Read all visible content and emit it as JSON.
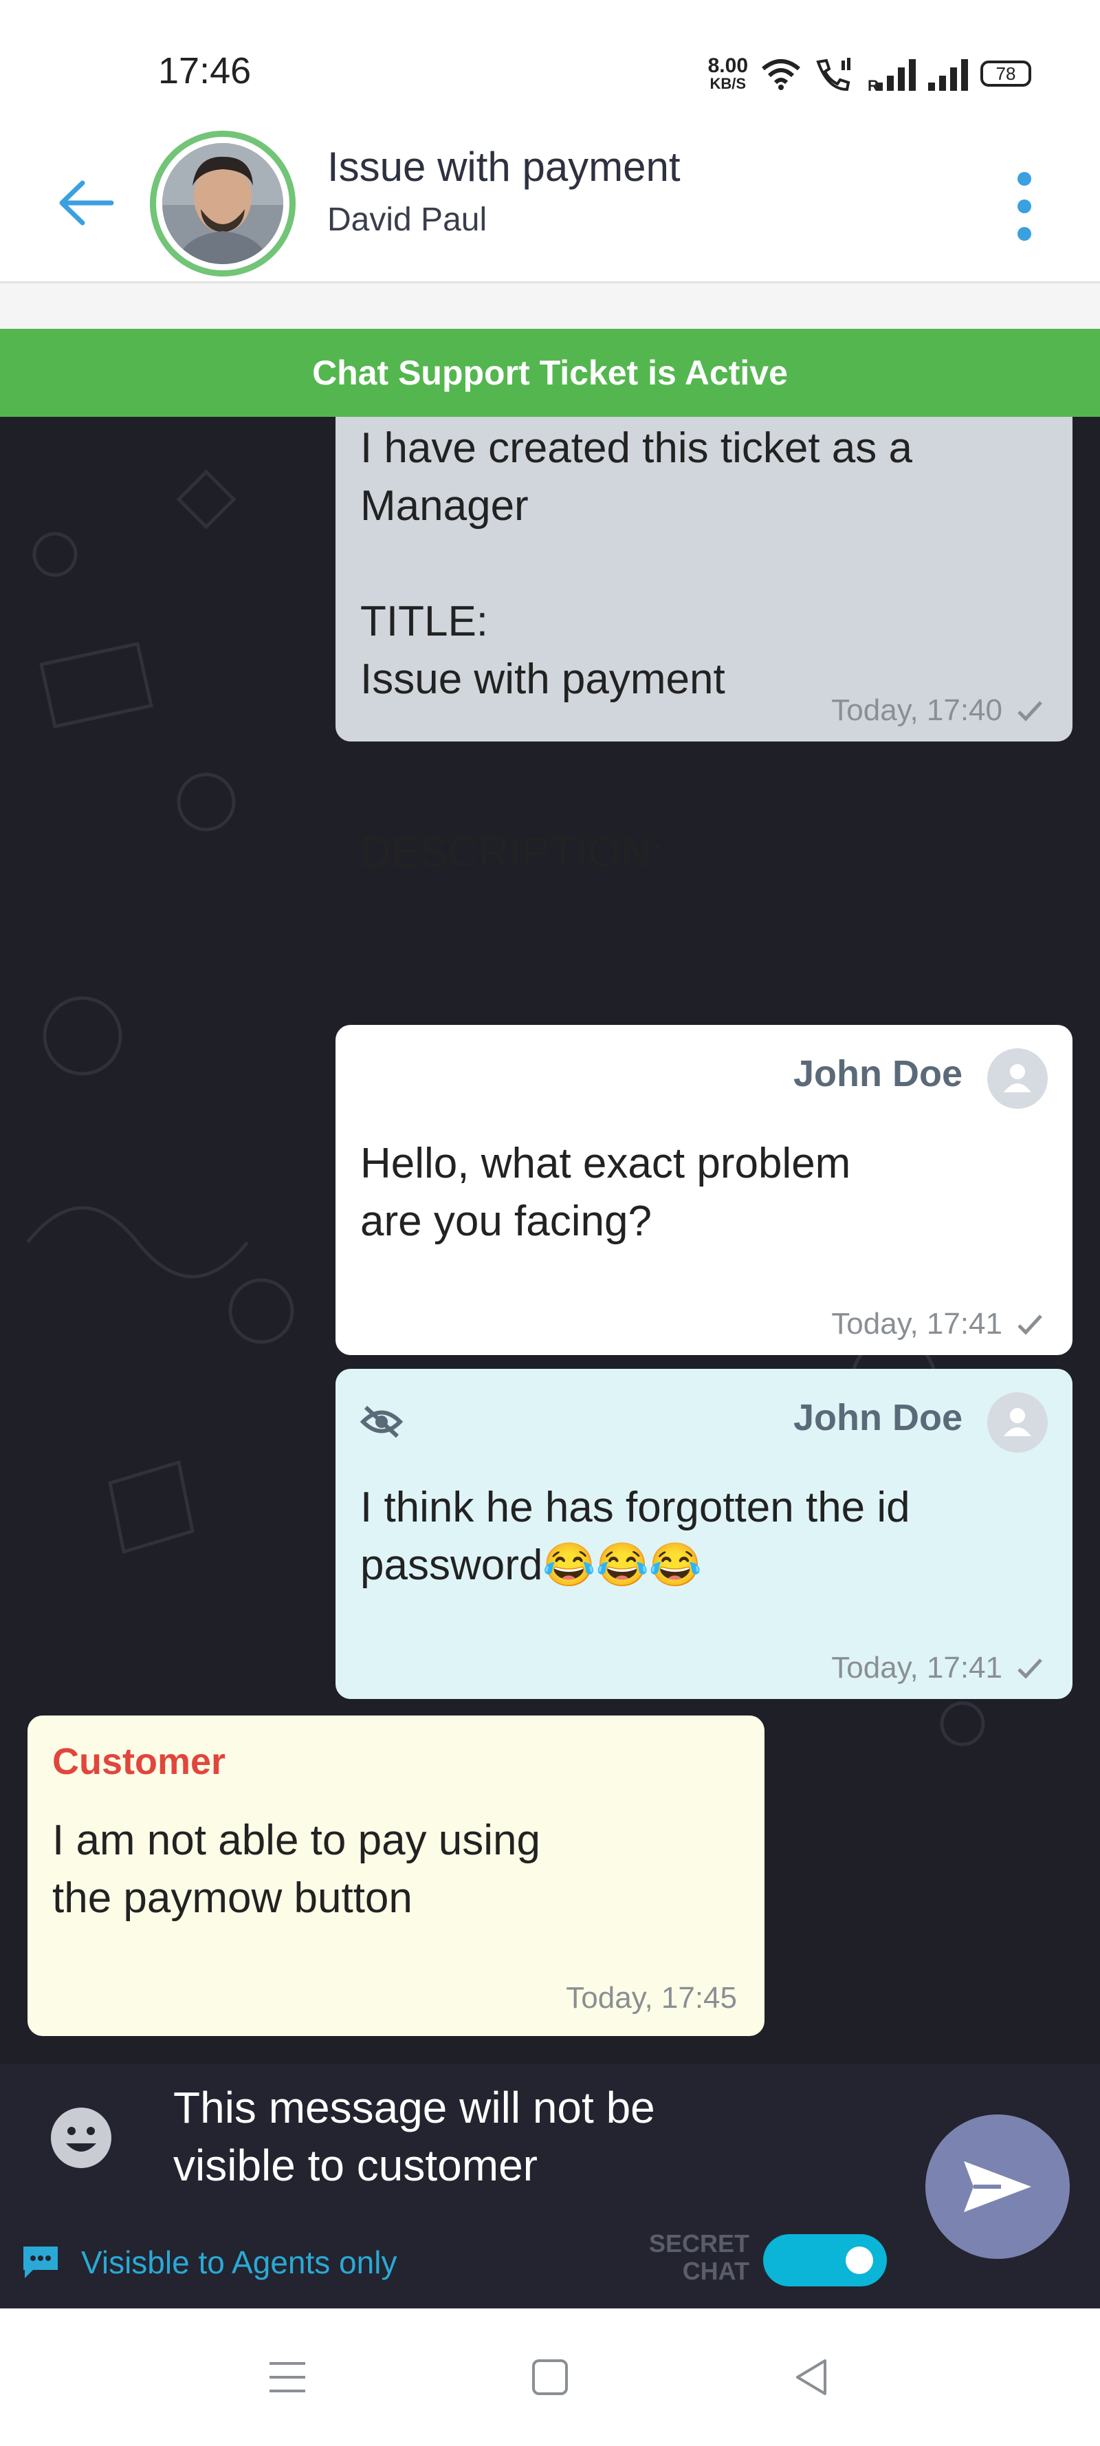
{
  "status_bar": {
    "time": "17:46",
    "net_speed": "8.00",
    "net_unit": "KB/S",
    "battery": "78",
    "icons": [
      "wifi-icon",
      "call-signal-icon",
      "signal-r-icon",
      "signal-icon",
      "battery-icon"
    ]
  },
  "header": {
    "title": "Issue with payment",
    "subtitle": "David Paul",
    "colors": {
      "back": "#3aa0e0",
      "ring": "#72c477",
      "menu": "#3aa0e0"
    }
  },
  "banner": {
    "text": "Chat Support Ticket is Active",
    "color": "#54b64f"
  },
  "messages": [
    {
      "type": "system",
      "lines": "I have created this ticket as a\nManager\n\nTITLE:\nIssue with payment\n\n\nDESCRIPTION:",
      "time": "Today,  17:40",
      "bg": "#d0d6db"
    },
    {
      "type": "agent",
      "sender": "John Doe",
      "text": "Hello, what exact problem\nare you facing?",
      "time": "Today,  17:41",
      "bg": "#ffffff"
    },
    {
      "type": "agent-secret",
      "sender": "John Doe",
      "text": "I think he has forgotten the id\npassword😂😂😂",
      "time": "Today,  17:41",
      "bg": "#dff4f7"
    },
    {
      "type": "customer",
      "sender": "Customer",
      "text": "I am not able to pay using\nthe paymow button",
      "time": "Today,  17:45",
      "bg": "#fdfce7",
      "sender_color": "#e0463c"
    }
  ],
  "composer": {
    "text": "This message will not be\nvisible to customer",
    "visibility_label": "Visisble to Agents only",
    "secret_label": "SECRET\nCHAT",
    "secret_chat_on": true,
    "toggle_color": "#0ab5d7",
    "send_color": "#7b84b0"
  }
}
